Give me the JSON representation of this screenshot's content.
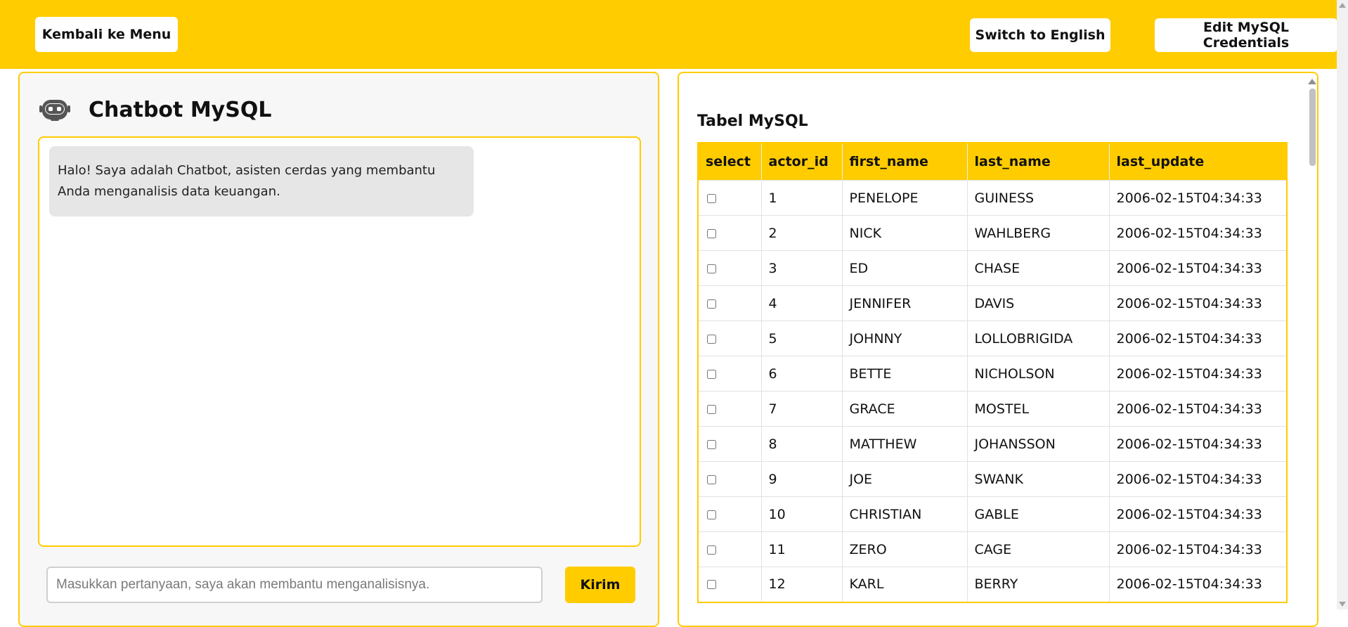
{
  "topbar": {
    "back_label": "Kembali ke Menu",
    "lang_label": "Switch to English",
    "cred_label": "Edit MySQL Credentials",
    "bg_color": "#ffcc00"
  },
  "chat": {
    "icon": "robot-icon",
    "title": "Chatbot MySQL",
    "messages": [
      {
        "sender": "bot",
        "text": "Halo! Saya adalah Chatbot, asisten cerdas yang membantu Anda menganalisis data keuangan."
      }
    ],
    "input_placeholder": "Masukkan pertanyaan, saya akan membantu menganalisisnya.",
    "input_value": "",
    "send_label": "Kirim"
  },
  "table": {
    "title": "Tabel MySQL",
    "columns": [
      "select",
      "actor_id",
      "first_name",
      "last_name",
      "last_update"
    ],
    "rows": [
      [
        "1",
        "PENELOPE",
        "GUINESS",
        "2006-02-15T04:34:33"
      ],
      [
        "2",
        "NICK",
        "WAHLBERG",
        "2006-02-15T04:34:33"
      ],
      [
        "3",
        "ED",
        "CHASE",
        "2006-02-15T04:34:33"
      ],
      [
        "4",
        "JENNIFER",
        "DAVIS",
        "2006-02-15T04:34:33"
      ],
      [
        "5",
        "JOHNNY",
        "LOLLOBRIGIDA",
        "2006-02-15T04:34:33"
      ],
      [
        "6",
        "BETTE",
        "NICHOLSON",
        "2006-02-15T04:34:33"
      ],
      [
        "7",
        "GRACE",
        "MOSTEL",
        "2006-02-15T04:34:33"
      ],
      [
        "8",
        "MATTHEW",
        "JOHANSSON",
        "2006-02-15T04:34:33"
      ],
      [
        "9",
        "JOE",
        "SWANK",
        "2006-02-15T04:34:33"
      ],
      [
        "10",
        "CHRISTIAN",
        "GABLE",
        "2006-02-15T04:34:33"
      ],
      [
        "11",
        "ZERO",
        "CAGE",
        "2006-02-15T04:34:33"
      ],
      [
        "12",
        "KARL",
        "BERRY",
        "2006-02-15T04:34:33"
      ]
    ]
  }
}
